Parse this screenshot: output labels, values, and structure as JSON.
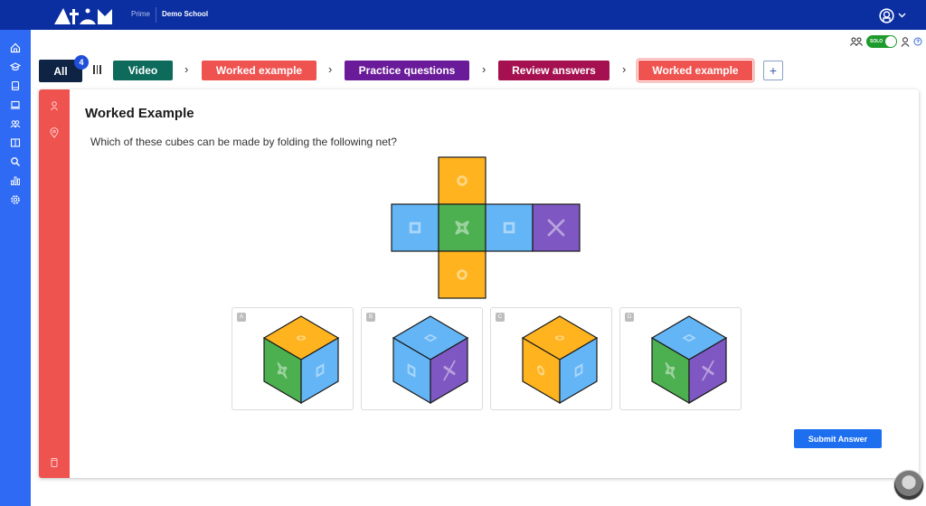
{
  "header": {
    "logo_name": "Atom",
    "product": "Prime",
    "school": "Demo School",
    "user_menu_icon": "user-circle-icon",
    "chevron_icon": "chevron-down-icon"
  },
  "sidebar": {
    "items": [
      {
        "icon": "home-icon"
      },
      {
        "icon": "graduation-cap-icon"
      },
      {
        "icon": "book-icon"
      },
      {
        "icon": "laptop-icon"
      },
      {
        "icon": "users-icon"
      },
      {
        "icon": "open-book-icon"
      },
      {
        "icon": "search-icon"
      },
      {
        "icon": "bar-chart-icon"
      },
      {
        "icon": "gear-icon"
      }
    ]
  },
  "controls": {
    "group_icon": "group-icon",
    "toggle_label": "SOLO",
    "toggle_on": true,
    "person_icon": "person-icon",
    "help_icon": "help-icon"
  },
  "steps": {
    "all_label": "All",
    "all_count": "4",
    "items": [
      {
        "label": "Video",
        "color": "#0e6b5c"
      },
      {
        "label": "Worked example",
        "color": "#ef5350"
      },
      {
        "label": "Practice questions",
        "color": "#6a1b9a"
      },
      {
        "label": "Review answers",
        "color": "#a51150"
      },
      {
        "label": "Worked example",
        "color": "#ef5350",
        "active": true
      }
    ],
    "add_label": "+"
  },
  "card": {
    "rail_icons": [
      "person-icon",
      "location-pin-icon",
      "device-icon"
    ],
    "title": "Worked Example",
    "question": "Which of these cubes can be made by folding the following net?",
    "net": {
      "faces": [
        {
          "pos": "top",
          "color": "#ffb41f",
          "symbol": "circle"
        },
        {
          "pos": "left",
          "color": "#64b5f6",
          "symbol": "square"
        },
        {
          "pos": "center",
          "color": "#4caf50",
          "symbol": "star"
        },
        {
          "pos": "right",
          "color": "#64b5f6",
          "symbol": "square"
        },
        {
          "pos": "far-right",
          "color": "#7e57c2",
          "symbol": "cross"
        },
        {
          "pos": "bottom",
          "color": "#ffb41f",
          "symbol": "circle"
        }
      ]
    },
    "options": [
      {
        "label": "A",
        "top": "#ffb41f",
        "left": "#4caf50",
        "right": "#64b5f6"
      },
      {
        "label": "B",
        "top": "#64b5f6",
        "left": "#64b5f6",
        "right": "#7e57c2"
      },
      {
        "label": "C",
        "top": "#ffb41f",
        "left": "#ffb41f",
        "right": "#64b5f6"
      },
      {
        "label": "D",
        "top": "#64b5f6",
        "left": "#4caf50",
        "right": "#7e57c2"
      }
    ],
    "submit_label": "Submit Answer"
  },
  "colors": {
    "header": "#0b2ea1",
    "sidebar": "#2f6af5",
    "accent": "#1e6ff0",
    "rail": "#ef5350"
  }
}
